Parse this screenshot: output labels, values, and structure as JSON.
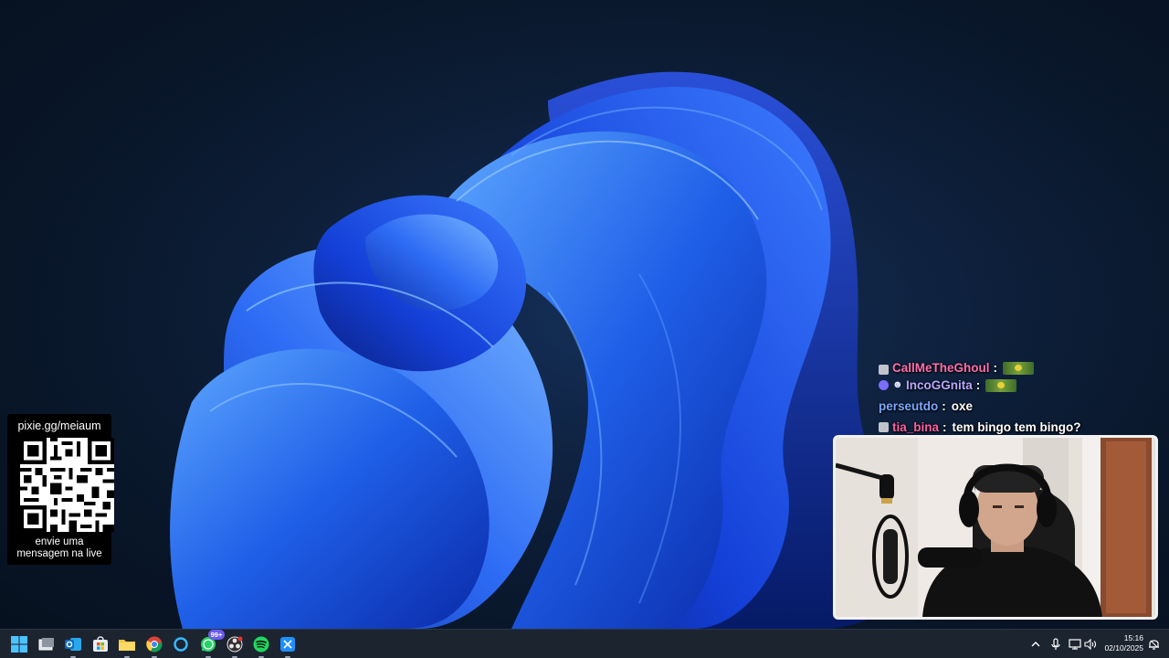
{
  "overlay": {
    "qr_url": "pixie.gg/meiaum",
    "qr_caption_line1": "envie uma",
    "qr_caption_line2": "mensagem na live"
  },
  "chat": {
    "messages": [
      {
        "user": "CallMeTheGhoul",
        "user_color": "#ff6fae",
        "text": "",
        "emote": "pepe-emote",
        "badge": "square"
      },
      {
        "user": "IncoGGnita",
        "user_color": "#b8a8ff",
        "text": "",
        "emote": "pepe-emote",
        "badge": "circle-mask"
      },
      {
        "user": "perseutdo",
        "user_color": "#7aa7ff",
        "text": "oxe",
        "badge": "none"
      },
      {
        "user": "tia_bina",
        "user_color": "#ff5fa3",
        "text": "tem bingo tem bingo?",
        "badge": "square"
      }
    ],
    "separator": ":"
  },
  "taskbar": {
    "apps": [
      {
        "name": "start",
        "icon": "windows-logo-icon"
      },
      {
        "name": "task-view",
        "icon": "task-view-icon"
      },
      {
        "name": "outlook",
        "icon": "outlook-icon"
      },
      {
        "name": "store",
        "icon": "store-icon"
      },
      {
        "name": "file-explorer",
        "icon": "folder-icon"
      },
      {
        "name": "chrome",
        "icon": "chrome-icon"
      },
      {
        "name": "cortana",
        "icon": "cortana-ring-icon"
      },
      {
        "name": "whatsapp",
        "icon": "whatsapp-icon",
        "badge": "99+"
      },
      {
        "name": "obs",
        "icon": "obs-icon"
      },
      {
        "name": "spotify",
        "icon": "spotify-icon"
      },
      {
        "name": "snipping-tool",
        "icon": "snipping-tool-icon"
      }
    ],
    "tray": {
      "icons": [
        "chevron-up-icon",
        "microphone-icon",
        "network-icon",
        "speaker-icon",
        "notification-icon"
      ],
      "time": "15:16",
      "date": "02/10/2025"
    }
  },
  "colors": {
    "desktop_bg": "#0b1a30",
    "wallpaper_blue": "#1f5fe8",
    "taskbar_bg": "#1c2430",
    "accent": "#6a5cf0"
  }
}
